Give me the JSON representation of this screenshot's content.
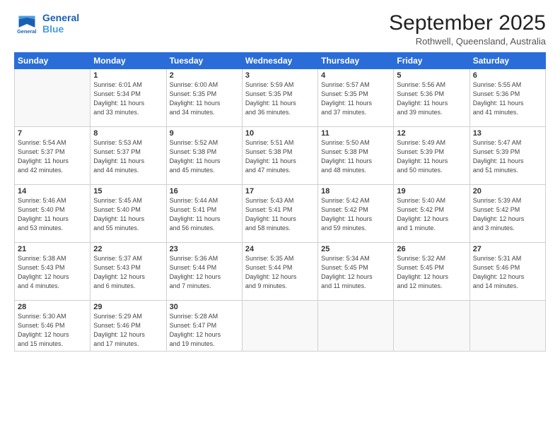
{
  "header": {
    "logo_line1": "General",
    "logo_line2": "Blue",
    "month": "September 2025",
    "location": "Rothwell, Queensland, Australia"
  },
  "days_of_week": [
    "Sunday",
    "Monday",
    "Tuesday",
    "Wednesday",
    "Thursday",
    "Friday",
    "Saturday"
  ],
  "weeks": [
    [
      {
        "day": "",
        "info": ""
      },
      {
        "day": "1",
        "info": "Sunrise: 6:01 AM\nSunset: 5:34 PM\nDaylight: 11 hours\nand 33 minutes."
      },
      {
        "day": "2",
        "info": "Sunrise: 6:00 AM\nSunset: 5:35 PM\nDaylight: 11 hours\nand 34 minutes."
      },
      {
        "day": "3",
        "info": "Sunrise: 5:59 AM\nSunset: 5:35 PM\nDaylight: 11 hours\nand 36 minutes."
      },
      {
        "day": "4",
        "info": "Sunrise: 5:57 AM\nSunset: 5:35 PM\nDaylight: 11 hours\nand 37 minutes."
      },
      {
        "day": "5",
        "info": "Sunrise: 5:56 AM\nSunset: 5:36 PM\nDaylight: 11 hours\nand 39 minutes."
      },
      {
        "day": "6",
        "info": "Sunrise: 5:55 AM\nSunset: 5:36 PM\nDaylight: 11 hours\nand 41 minutes."
      }
    ],
    [
      {
        "day": "7",
        "info": "Sunrise: 5:54 AM\nSunset: 5:37 PM\nDaylight: 11 hours\nand 42 minutes."
      },
      {
        "day": "8",
        "info": "Sunrise: 5:53 AM\nSunset: 5:37 PM\nDaylight: 11 hours\nand 44 minutes."
      },
      {
        "day": "9",
        "info": "Sunrise: 5:52 AM\nSunset: 5:38 PM\nDaylight: 11 hours\nand 45 minutes."
      },
      {
        "day": "10",
        "info": "Sunrise: 5:51 AM\nSunset: 5:38 PM\nDaylight: 11 hours\nand 47 minutes."
      },
      {
        "day": "11",
        "info": "Sunrise: 5:50 AM\nSunset: 5:38 PM\nDaylight: 11 hours\nand 48 minutes."
      },
      {
        "day": "12",
        "info": "Sunrise: 5:49 AM\nSunset: 5:39 PM\nDaylight: 11 hours\nand 50 minutes."
      },
      {
        "day": "13",
        "info": "Sunrise: 5:47 AM\nSunset: 5:39 PM\nDaylight: 11 hours\nand 51 minutes."
      }
    ],
    [
      {
        "day": "14",
        "info": "Sunrise: 5:46 AM\nSunset: 5:40 PM\nDaylight: 11 hours\nand 53 minutes."
      },
      {
        "day": "15",
        "info": "Sunrise: 5:45 AM\nSunset: 5:40 PM\nDaylight: 11 hours\nand 55 minutes."
      },
      {
        "day": "16",
        "info": "Sunrise: 5:44 AM\nSunset: 5:41 PM\nDaylight: 11 hours\nand 56 minutes."
      },
      {
        "day": "17",
        "info": "Sunrise: 5:43 AM\nSunset: 5:41 PM\nDaylight: 11 hours\nand 58 minutes."
      },
      {
        "day": "18",
        "info": "Sunrise: 5:42 AM\nSunset: 5:42 PM\nDaylight: 11 hours\nand 59 minutes."
      },
      {
        "day": "19",
        "info": "Sunrise: 5:40 AM\nSunset: 5:42 PM\nDaylight: 12 hours\nand 1 minute."
      },
      {
        "day": "20",
        "info": "Sunrise: 5:39 AM\nSunset: 5:42 PM\nDaylight: 12 hours\nand 3 minutes."
      }
    ],
    [
      {
        "day": "21",
        "info": "Sunrise: 5:38 AM\nSunset: 5:43 PM\nDaylight: 12 hours\nand 4 minutes."
      },
      {
        "day": "22",
        "info": "Sunrise: 5:37 AM\nSunset: 5:43 PM\nDaylight: 12 hours\nand 6 minutes."
      },
      {
        "day": "23",
        "info": "Sunrise: 5:36 AM\nSunset: 5:44 PM\nDaylight: 12 hours\nand 7 minutes."
      },
      {
        "day": "24",
        "info": "Sunrise: 5:35 AM\nSunset: 5:44 PM\nDaylight: 12 hours\nand 9 minutes."
      },
      {
        "day": "25",
        "info": "Sunrise: 5:34 AM\nSunset: 5:45 PM\nDaylight: 12 hours\nand 11 minutes."
      },
      {
        "day": "26",
        "info": "Sunrise: 5:32 AM\nSunset: 5:45 PM\nDaylight: 12 hours\nand 12 minutes."
      },
      {
        "day": "27",
        "info": "Sunrise: 5:31 AM\nSunset: 5:46 PM\nDaylight: 12 hours\nand 14 minutes."
      }
    ],
    [
      {
        "day": "28",
        "info": "Sunrise: 5:30 AM\nSunset: 5:46 PM\nDaylight: 12 hours\nand 15 minutes."
      },
      {
        "day": "29",
        "info": "Sunrise: 5:29 AM\nSunset: 5:46 PM\nDaylight: 12 hours\nand 17 minutes."
      },
      {
        "day": "30",
        "info": "Sunrise: 5:28 AM\nSunset: 5:47 PM\nDaylight: 12 hours\nand 19 minutes."
      },
      {
        "day": "",
        "info": ""
      },
      {
        "day": "",
        "info": ""
      },
      {
        "day": "",
        "info": ""
      },
      {
        "day": "",
        "info": ""
      }
    ]
  ]
}
